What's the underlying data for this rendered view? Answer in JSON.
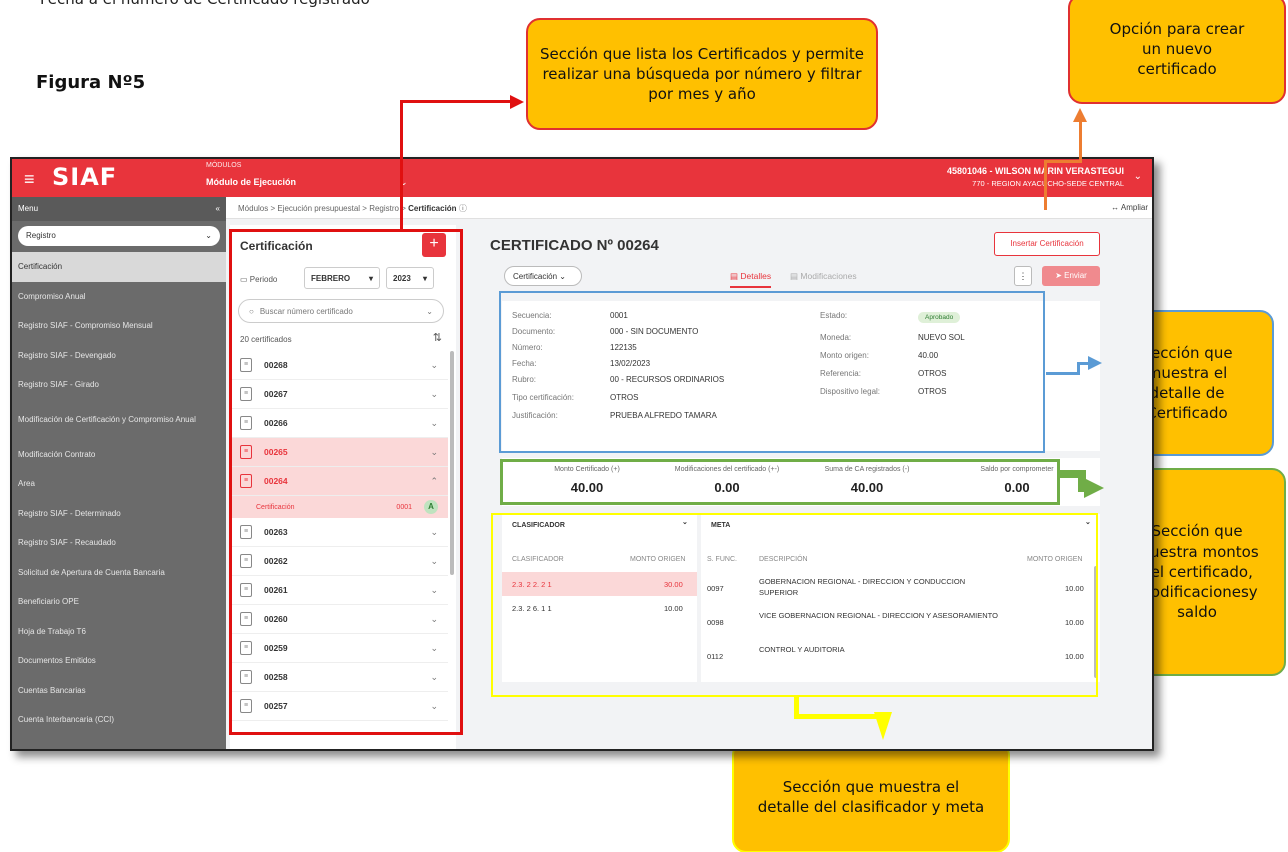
{
  "document": {
    "cut_line": "Fecha a el número de Certificado registrado",
    "figure_label": "Figura Nº5"
  },
  "callouts": {
    "list": "Sección que lista los Certificados y permite realizar una búsqueda por número y filtrar por mes y año",
    "create": "Opción para crear un nuevo certificado",
    "detail": "Sección que muestra el detalle de Certificado",
    "amounts": "Sección que muestra montos del certificado, modificacionesy saldo",
    "classifier": "Sección que muestra el detalle del clasificador y meta"
  },
  "app": {
    "hamburger": "≡",
    "logo": "SIAF",
    "modules_label": "MÓDULOS",
    "module_name": "Módulo de Ejecución",
    "user_line1": "45801046 - WILSON MARIN VERASTEGUI",
    "user_line2": "770 - REGION AYACUCHO-SEDE CENTRAL"
  },
  "sidebar": {
    "header": "Menu",
    "collapse": "«",
    "select_value": "Registro",
    "items": [
      {
        "label": "Certificación",
        "active": true
      },
      {
        "label": "Compromiso Anual"
      },
      {
        "label": "Registro SIAF - Compromiso Mensual"
      },
      {
        "label": "Registro SIAF - Devengado"
      },
      {
        "label": "Registro SIAF - Girado"
      },
      {
        "label": "Modificación de Certificación y Compromiso Anual"
      },
      {
        "label": "Modificación Contrato"
      },
      {
        "label": "Area"
      },
      {
        "label": "Registro SIAF - Determinado"
      },
      {
        "label": "Registro SIAF - Recaudado"
      },
      {
        "label": "Solicitud de Apertura de Cuenta Bancaria"
      },
      {
        "label": "Beneficiario OPE"
      },
      {
        "label": "Hoja de Trabajo T6"
      },
      {
        "label": "Documentos Emitidos"
      },
      {
        "label": "Cuentas Bancarias"
      },
      {
        "label": "Cuenta Interbancaria (CCI)"
      }
    ]
  },
  "breadcrumb": {
    "path": "Módulos > Ejecución presupuestal > Registro > ",
    "current": "Certificación",
    "expand": "↔ Ampliar"
  },
  "list": {
    "title": "Certificación",
    "add": "+",
    "period_label": "Periodo",
    "month": "FEBRERO",
    "year": "2023",
    "search_placeholder": "Buscar número certificado",
    "count": "20 certificados",
    "rows": [
      "00268",
      "00267",
      "00266",
      "00265",
      "00264",
      "00263",
      "00262",
      "00261",
      "00260",
      "00259",
      "00258",
      "00257"
    ],
    "expanded_sub": {
      "label": "Certificación",
      "number": "0001",
      "badge": "A"
    }
  },
  "detail": {
    "title": "CERTIFICADO Nº 00264",
    "insert_button": "Insertar Certificación",
    "type_select": "Certificación",
    "tab_details": "Detalles",
    "tab_modifications": "Modificaciones",
    "send_button": "Enviar",
    "more": "⋮",
    "fields_left": [
      {
        "label": "Secuencia:",
        "value": "0001"
      },
      {
        "label": "Documento:",
        "value": "000 - SIN DOCUMENTO"
      },
      {
        "label": "Número:",
        "value": "122135"
      },
      {
        "label": "Fecha:",
        "value": "13/02/2023"
      },
      {
        "label": "Rubro:",
        "value": "00 - RECURSOS ORDINARIOS"
      },
      {
        "label": "Tipo certificación:",
        "value": "OTROS"
      },
      {
        "label": "Justificación:",
        "value": "PRUEBA ALFREDO TAMARA"
      }
    ],
    "fields_right": [
      {
        "label": "Estado:",
        "value": "Aprobado"
      },
      {
        "label": "Moneda:",
        "value": "NUEVO SOL"
      },
      {
        "label": "Monto origen:",
        "value": "40.00"
      },
      {
        "label": "Referencia:",
        "value": "OTROS"
      },
      {
        "label": "Dispositivo legal:",
        "value": "OTROS"
      }
    ]
  },
  "amounts": [
    {
      "label": "Monto Certificado (+)",
      "value": "40.00"
    },
    {
      "label": "Modificaciones del certificado (+-)",
      "value": "0.00"
    },
    {
      "label": "Suma de CA registrados (-)",
      "value": "40.00"
    },
    {
      "label": "Saldo por comprometer",
      "value": "0.00"
    }
  ],
  "classifier": {
    "title": "CLASIFICADOR",
    "col1": "CLASIFICADOR",
    "col2": "MONTO ORIGEN",
    "rows": [
      {
        "code": "2.3. 2 2. 2 1",
        "amount": "30.00",
        "highlight": true
      },
      {
        "code": "2.3. 2 6. 1 1",
        "amount": "10.00"
      }
    ]
  },
  "meta": {
    "title": "META",
    "col1": "S. FUNC.",
    "col2": "DESCRIPCIÓN",
    "col3": "MONTO ORIGEN",
    "rows": [
      {
        "sfunc": "0097",
        "desc": "GOBERNACION REGIONAL - DIRECCION Y CONDUCCION SUPERIOR",
        "amount": "10.00"
      },
      {
        "sfunc": "0098",
        "desc": "VICE GOBERNACION REGIONAL - DIRECCION Y ASESORAMIENTO",
        "amount": "10.00"
      },
      {
        "sfunc": "0112",
        "desc": "CONTROL Y AUDITORIA",
        "amount": "10.00"
      }
    ]
  },
  "colors": {
    "brand_red": "#e8343c",
    "callout_fill": "#ffc000",
    "box_red": "#e01010",
    "box_blue": "#5b9bd5",
    "box_green": "#70ad47",
    "box_yellow": "#ffff00",
    "arrow_orange": "#ed7d31"
  }
}
